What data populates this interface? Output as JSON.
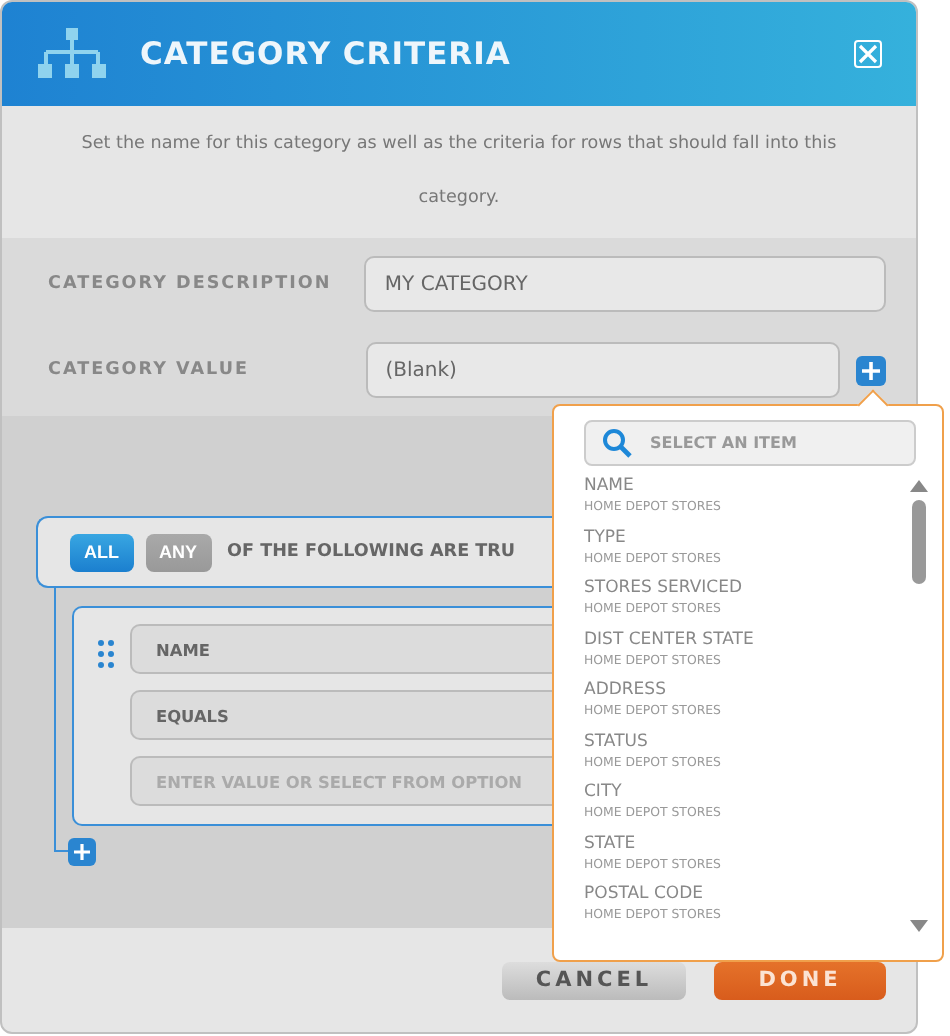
{
  "dialog": {
    "title": "CATEGORY CRITERIA",
    "description": "Set the name for this category as well as the criteria for rows that should fall into this category."
  },
  "form": [
    {
      "label": "CATEGORY DESCRIPTION",
      "value": "MY CATEGORY",
      "kind": "text"
    },
    {
      "label": "CATEGORY VALUE",
      "value": "(Blank)",
      "kind": "picker"
    }
  ],
  "criteria": {
    "modes": [
      {
        "label": "ALL",
        "selected": true
      },
      {
        "label": "ANY",
        "selected": false
      }
    ],
    "suffix": "OF THE FOLLOWING ARE TRU",
    "condition": {
      "field": "NAME",
      "operator": "EQUALS",
      "value_placeholder": "ENTER VALUE OR SELECT FROM OPTION"
    }
  },
  "dropdown": {
    "search_placeholder": "SELECT AN ITEM",
    "items": [
      {
        "name": "NAME",
        "source": "HOME DEPOT STORES"
      },
      {
        "name": "TYPE",
        "source": "HOME DEPOT STORES"
      },
      {
        "name": "STORES SERVICED",
        "source": "HOME DEPOT STORES"
      },
      {
        "name": "DIST CENTER STATE",
        "source": "HOME DEPOT STORES"
      },
      {
        "name": "ADDRESS",
        "source": "HOME DEPOT STORES"
      },
      {
        "name": "STATUS",
        "source": "HOME DEPOT STORES"
      },
      {
        "name": "CITY",
        "source": "HOME DEPOT STORES"
      },
      {
        "name": "STATE",
        "source": "HOME DEPOT STORES"
      },
      {
        "name": "POSTAL CODE",
        "source": "HOME DEPOT STORES"
      }
    ]
  },
  "buttons": [
    {
      "label": "CANCEL",
      "kind": "secondary"
    },
    {
      "label": "DONE",
      "kind": "primary"
    }
  ]
}
